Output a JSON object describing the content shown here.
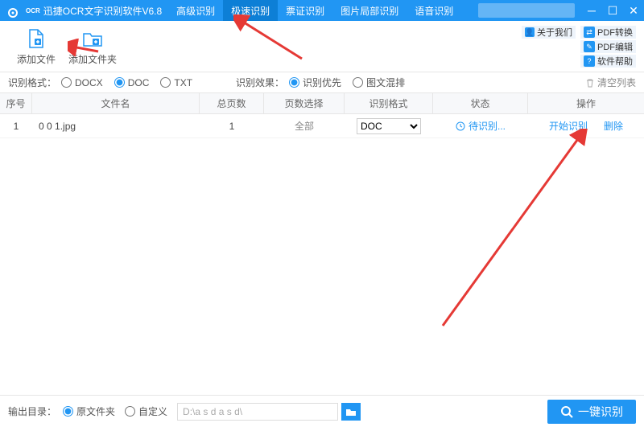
{
  "titlebar": {
    "logo_text": "OCR",
    "title": "迅捷OCR文字识别软件V6.8",
    "tabs": [
      {
        "label": "高级识别",
        "active": false
      },
      {
        "label": "极速识别",
        "active": true
      },
      {
        "label": "票证识别",
        "active": false
      },
      {
        "label": "图片局部识别",
        "active": false
      },
      {
        "label": "语音识别",
        "active": false
      }
    ]
  },
  "toolbar": {
    "add_file": "添加文件",
    "add_folder": "添加文件夹",
    "about": "关于我们",
    "pdf_convert": "PDF转换",
    "pdf_edit": "PDF编辑",
    "soft_help": "软件帮助"
  },
  "options": {
    "fmt_label": "识别格式：",
    "fmt_docx": "DOCX",
    "fmt_doc": "DOC",
    "fmt_txt": "TXT",
    "eff_label": "识别效果：",
    "eff_priority": "识别优先",
    "eff_mixed": "图文混排",
    "clear": "清空列表"
  },
  "thead": {
    "idx": "序号",
    "name": "文件名",
    "pages": "总页数",
    "pagesel": "页数选择",
    "fmt": "识别格式",
    "status": "状态",
    "ops": "操作"
  },
  "rows": [
    {
      "idx": "1",
      "name": "0 0 1.jpg",
      "pages": "1",
      "pagesel": "全部",
      "fmt": "DOC",
      "status": "待识别...",
      "op_start": "开始识别",
      "op_del": "删除"
    }
  ],
  "footer": {
    "out_label": "输出目录：",
    "opt_orig": "原文件夹",
    "opt_custom": "自定义",
    "path_value": "D:\\a s d a s d\\",
    "run": "一键识别"
  }
}
